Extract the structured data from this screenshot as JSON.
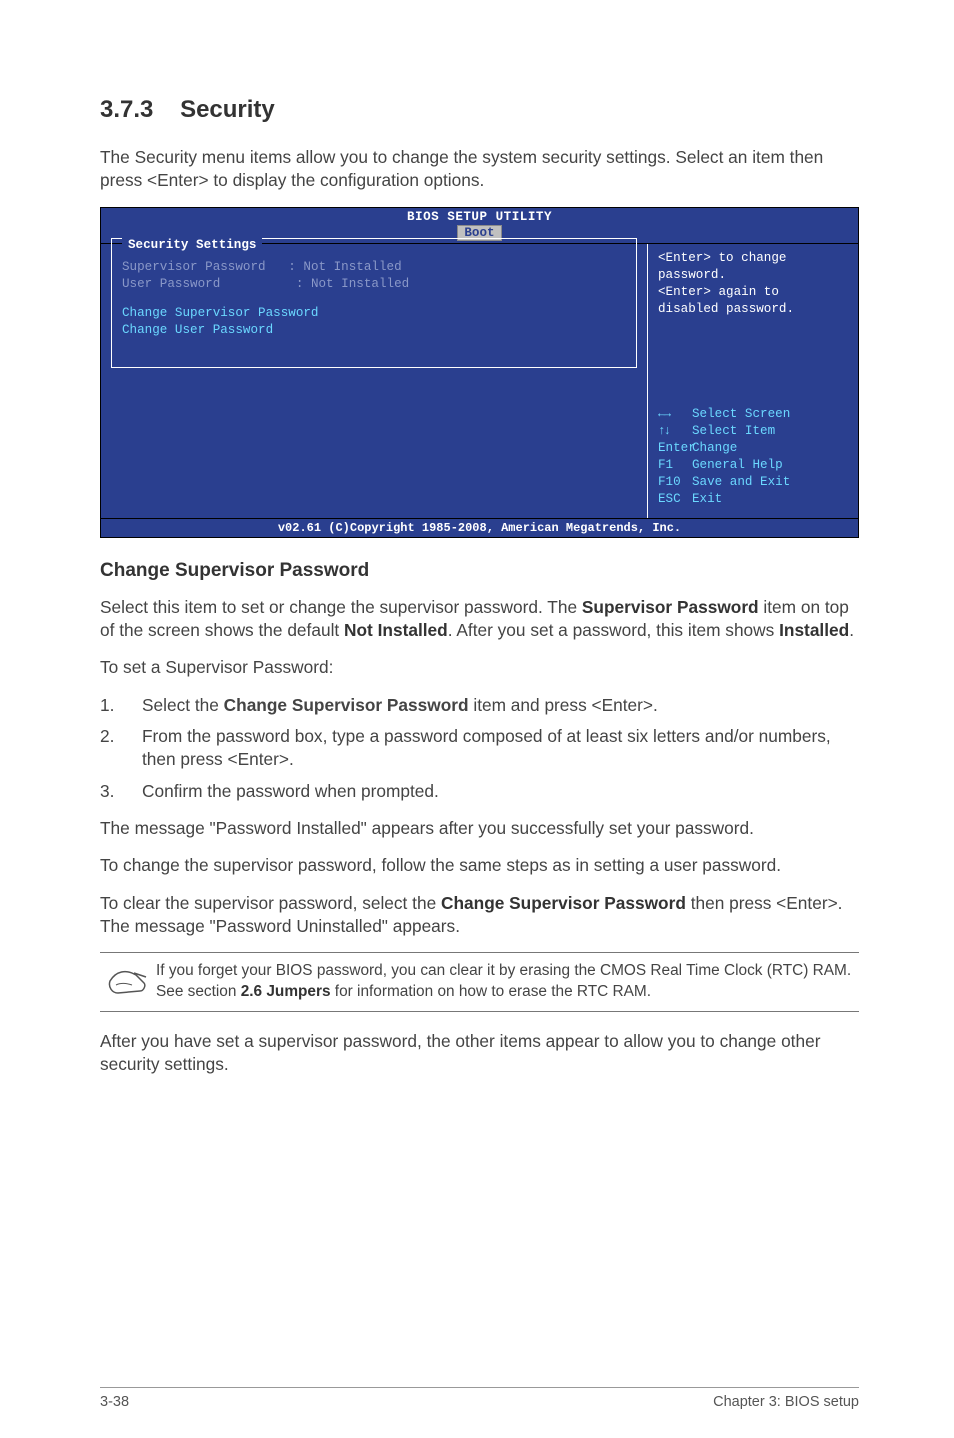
{
  "heading": {
    "number": "3.7.3",
    "title": "Security"
  },
  "intro": "The Security menu items allow you to change the system security settings. Select an item then press <Enter> to display the configuration options.",
  "bios": {
    "title": "BIOS SETUP UTILITY",
    "tab": "Boot",
    "panel_title": "Security Settings",
    "rows": {
      "sup_label": "Supervisor Password",
      "sup_value": ": Not Installed",
      "user_label": "User Password",
      "user_value": ": Not Installed",
      "change_sup": "Change Supervisor Password",
      "change_user": "Change User Password"
    },
    "help": {
      "l1": "<Enter> to change",
      "l2": "password.",
      "l3": "<Enter> again to",
      "l4": "disabled password."
    },
    "keys": {
      "select_screen": "Select Screen",
      "select_item": "Select Item",
      "enter": "Enter",
      "enter_txt": "Change",
      "f1": "F1",
      "f1_txt": "General Help",
      "f10": "F10",
      "f10_txt": "Save and Exit",
      "esc": "ESC",
      "esc_txt": "Exit"
    },
    "footer": "v02.61 (C)Copyright 1985-2008, American Megatrends, Inc."
  },
  "subheading": "Change Supervisor Password",
  "para1_a": "Select this item to set or change the supervisor password. The ",
  "para1_b": "Supervisor Password",
  "para1_c": " item on top of the screen shows the default ",
  "para1_d": "Not Installed",
  "para1_e": ". After you set a password, this item shows ",
  "para1_f": "Installed",
  "para1_g": ".",
  "para2": "To set a Supervisor Password:",
  "steps": [
    {
      "n": "1.",
      "a": "Select the ",
      "b": "Change Supervisor Password",
      "c": " item and press <Enter>."
    },
    {
      "n": "2.",
      "a": "From the password box, type a password composed of at least six letters and/or numbers, then press <Enter>.",
      "b": "",
      "c": ""
    },
    {
      "n": "3.",
      "a": "Confirm the password when prompted.",
      "b": "",
      "c": ""
    }
  ],
  "para3": "The message \"Password Installed\" appears after you successfully set your password.",
  "para4": "To change the supervisor password, follow the same steps as in setting a user password.",
  "para5_a": "To clear the supervisor password, select the ",
  "para5_b": "Change Supervisor Password",
  "para5_c": " then press <Enter>. The message \"Password Uninstalled\" appears.",
  "note_a": "If you forget your BIOS password, you can clear it by erasing the CMOS Real Time Clock (RTC) RAM. See section ",
  "note_b": "2.6 Jumpers",
  "note_c": " for information on how to erase the RTC RAM.",
  "para6": "After you have set a supervisor password, the other items appear to allow you to change other security settings.",
  "footer": {
    "left": "3-38",
    "right": "Chapter 3: BIOS setup"
  }
}
